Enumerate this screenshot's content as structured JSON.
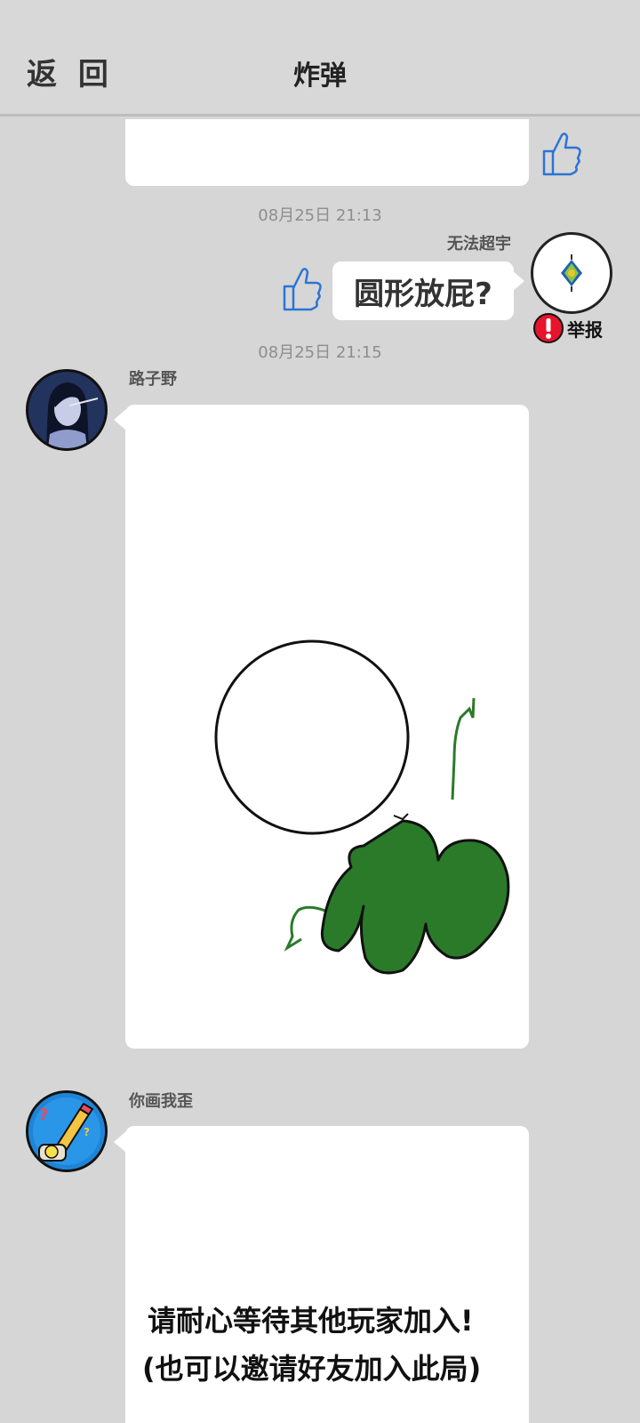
{
  "header": {
    "back_label": "返 回",
    "title": "炸弹"
  },
  "messages": [
    {
      "timestamp": "08月25日  21:13",
      "sender": "无法超宇",
      "text": "圆形放屁?",
      "report_label": "举报"
    },
    {
      "timestamp": "08月25日  21:15",
      "sender": "路子野"
    },
    {
      "sender": "你画我歪",
      "text_line1": "请耐心等待其他玩家加入!",
      "text_line2": "(也可以邀请好友加入此局)"
    }
  ],
  "colors": {
    "background": "#d6d6d6",
    "bubble": "#ffffff",
    "thumb_blue": "#2b74d6",
    "drawing_green": "#2a7a2a",
    "report_red": "#e8132c"
  },
  "icons": [
    "thumbs-up-icon",
    "alert-icon"
  ]
}
